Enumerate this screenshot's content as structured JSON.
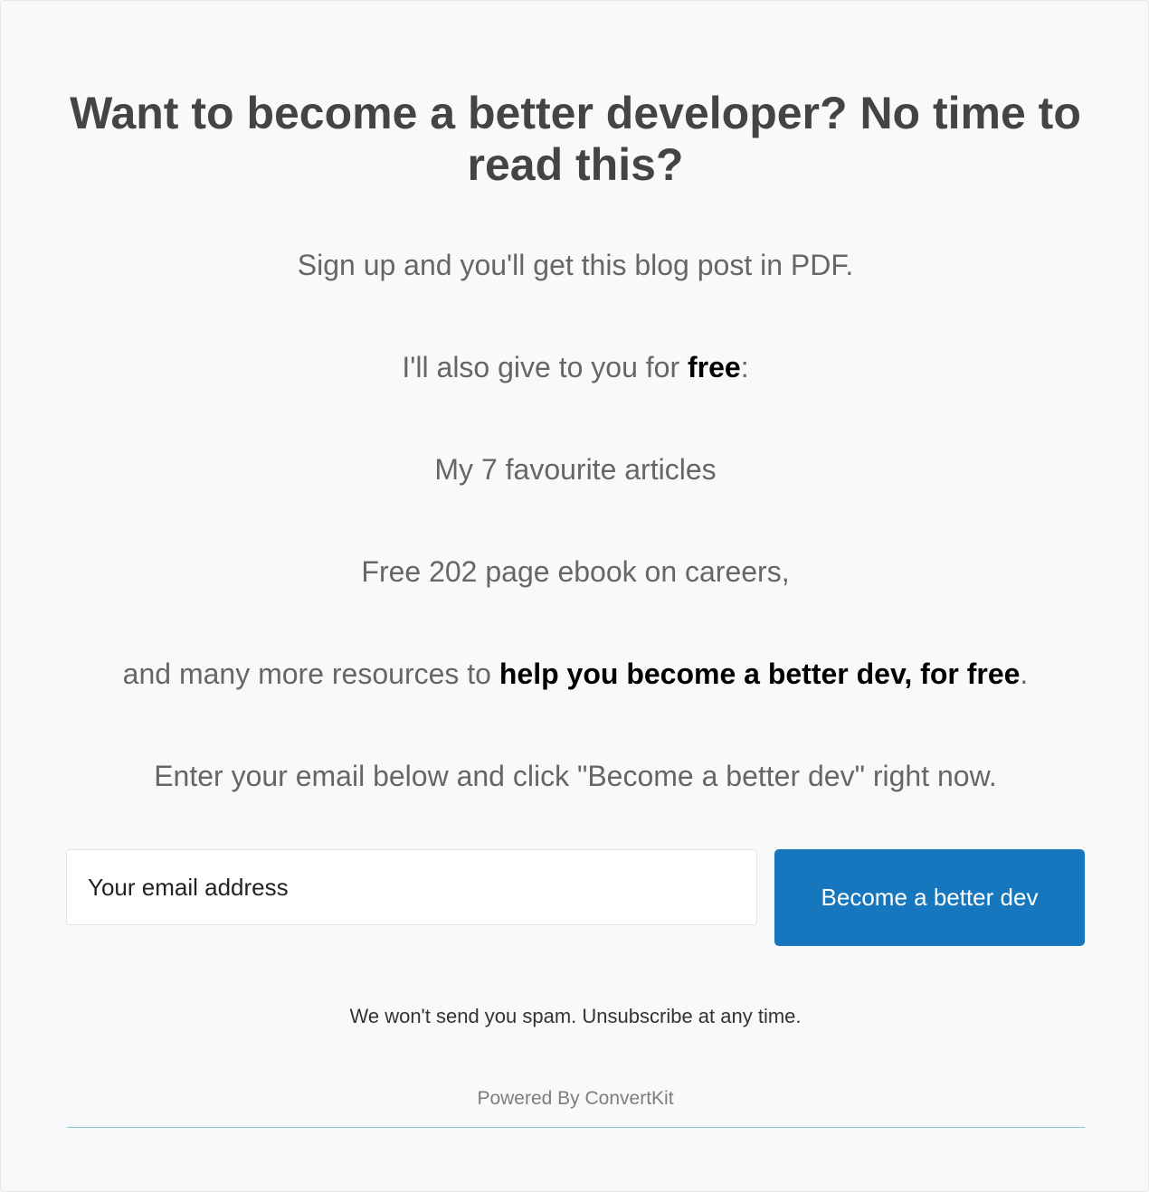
{
  "form": {
    "headline": "Want to become a better developer? No time to read this?",
    "paragraphs": {
      "p1": "Sign up and you'll get this blog post in PDF.",
      "p2_before": "I'll also give to you for ",
      "p2_bold": "free",
      "p2_after": ":",
      "p3": "My 7 favourite articles",
      "p4": "Free 202 page ebook on careers,",
      "p5_before": "and many more resources to ",
      "p5_bold": "help you become a better dev, for free",
      "p5_after": ".",
      "p6": "Enter your email below and click \"Become a better dev\" right now."
    },
    "email_placeholder": "Your email address",
    "email_value": "",
    "submit_label": "Become a better dev",
    "disclaimer": "We won't send you spam. Unsubscribe at any time.",
    "powered_by": "Powered By ConvertKit"
  },
  "colors": {
    "background": "#f8f9fb",
    "button": "#1677be",
    "button_text": "#ffffff",
    "heading": "#444444",
    "body_text": "#666666",
    "emphasis": "#000000",
    "footer_rule": "#7ec8d1"
  }
}
